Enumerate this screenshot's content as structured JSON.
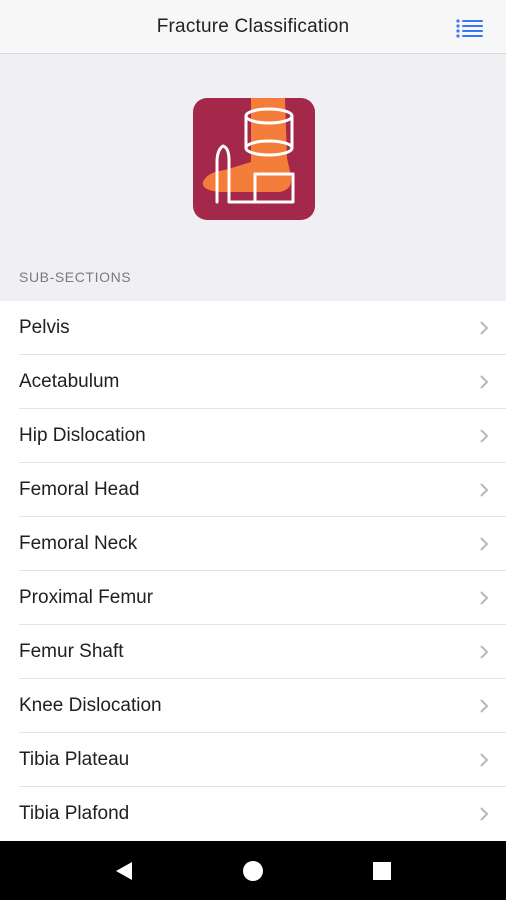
{
  "header": {
    "title": "Fracture Classification",
    "menu_icon": "list-icon",
    "accent": "#3478f6"
  },
  "hero": {
    "logo_icon": "leg-cast-icon",
    "logo_bg": "#a3284a",
    "logo_fg": "#f47d3b"
  },
  "section": {
    "header": "SUB-SECTIONS"
  },
  "list": {
    "items": [
      {
        "label": "Pelvis"
      },
      {
        "label": "Acetabulum"
      },
      {
        "label": "Hip Dislocation"
      },
      {
        "label": "Femoral Head"
      },
      {
        "label": "Femoral Neck"
      },
      {
        "label": "Proximal Femur"
      },
      {
        "label": "Femur Shaft"
      },
      {
        "label": "Knee Dislocation"
      },
      {
        "label": "Tibia Plateau"
      },
      {
        "label": "Tibia Plafond"
      }
    ],
    "chevron_icon": "chevron-right-icon"
  },
  "system_nav": {
    "back_icon": "back-triangle-icon",
    "home_icon": "home-circle-icon",
    "recents_icon": "recents-square-icon"
  }
}
